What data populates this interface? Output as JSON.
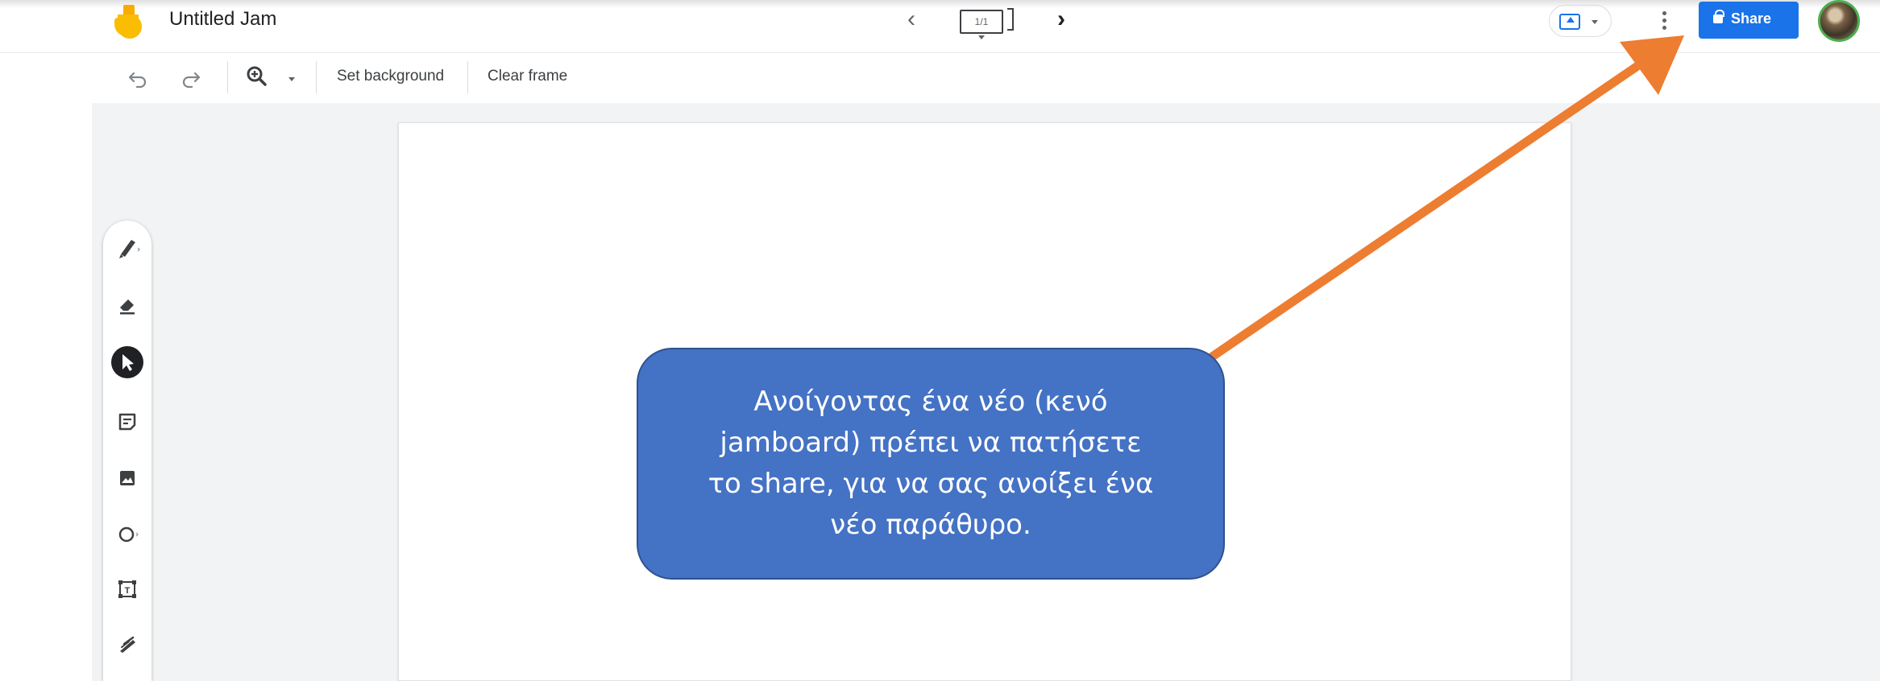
{
  "app": {
    "title": "Untitled Jam"
  },
  "frame_nav": {
    "indicator": "1/1"
  },
  "header": {
    "share_label": "Share"
  },
  "toolbar": {
    "set_background_label": "Set background",
    "clear_frame_label": "Clear frame"
  },
  "tools": [
    {
      "name": "pen-tool",
      "icon": "pen-icon"
    },
    {
      "name": "eraser-tool",
      "icon": "eraser-icon"
    },
    {
      "name": "select-tool",
      "icon": "cursor-icon",
      "selected": true
    },
    {
      "name": "sticky-note-tool",
      "icon": "sticky-note-icon"
    },
    {
      "name": "image-tool",
      "icon": "image-icon"
    },
    {
      "name": "circle-tool",
      "icon": "circle-icon"
    },
    {
      "name": "text-box-tool",
      "icon": "text-box-icon"
    },
    {
      "name": "laser-tool",
      "icon": "laser-icon"
    }
  ],
  "annotation": {
    "callout_text": "Ανοίγοντας ένα νέο (κενό\njamboard) πρέπει  να πατήσετε\nτο share, για να σας ανοίξει ένα\nνέο παράθυρο.",
    "callout_color": "#4472c4",
    "arrow_color": "#ed7d31"
  },
  "colors": {
    "accent": "#1a73e8",
    "workspace": "#f1f3f4"
  }
}
